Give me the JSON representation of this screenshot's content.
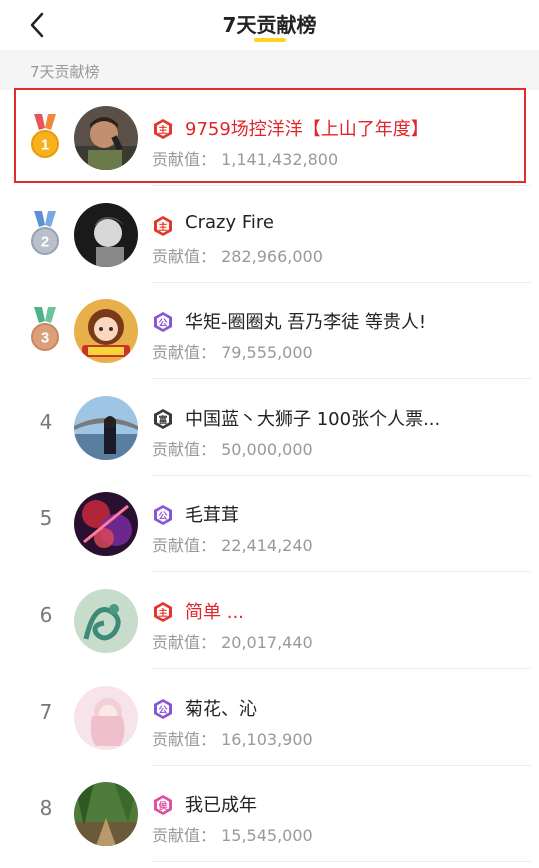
{
  "header": {
    "title": "7天贡献榜"
  },
  "section": {
    "label": "7天贡献榜"
  },
  "contribution_prefix": "贡献值：",
  "rows": [
    {
      "rank": "1",
      "medal": "gold",
      "badge": "主",
      "badge_type": "red",
      "name": "9759场控洋洋【上山了年度】",
      "name_red": true,
      "value": "1,141,432,800",
      "avatar": "avatar-photo-man-singing"
    },
    {
      "rank": "2",
      "medal": "silver",
      "badge": "主",
      "badge_type": "red",
      "name": "Crazy Fire",
      "name_red": false,
      "value": "282,966,000",
      "avatar": "avatar-photo-bw"
    },
    {
      "rank": "3",
      "medal": "bronze",
      "badge": "公",
      "badge_type": "purple",
      "name": "华矩-圈圈丸 吾乃李徒 等贵人!",
      "name_red": false,
      "value": "79,555,000",
      "avatar": "avatar-cartoon-girl"
    },
    {
      "rank": "4",
      "medal": "",
      "badge": "富",
      "badge_type": "dark",
      "name": "中国蓝丶大狮子 100张个人票...",
      "name_red": false,
      "value": "50,000,000",
      "avatar": "avatar-photo-woman-bridge"
    },
    {
      "rank": "5",
      "medal": "",
      "badge": "公",
      "badge_type": "purple",
      "name": "毛茸茸",
      "name_red": false,
      "value": "22,414,240",
      "avatar": "avatar-abstract-red"
    },
    {
      "rank": "6",
      "medal": "",
      "badge": "主",
      "badge_type": "red",
      "name": "简单 ...",
      "name_red": true,
      "value": "20,017,440",
      "avatar": "avatar-dragon-art"
    },
    {
      "rank": "7",
      "medal": "",
      "badge": "公",
      "badge_type": "purple",
      "name": "菊花、沁",
      "name_red": false,
      "value": "16,103,900",
      "avatar": "avatar-pink-girl"
    },
    {
      "rank": "8",
      "medal": "",
      "badge": "侯",
      "badge_type": "pink",
      "name": "我已成年",
      "name_red": false,
      "value": "15,545,000",
      "avatar": "avatar-forest"
    }
  ],
  "colors": {
    "highlight": "#e22b2b",
    "accent": "#ffd21e",
    "red_name": "#e0262a"
  }
}
